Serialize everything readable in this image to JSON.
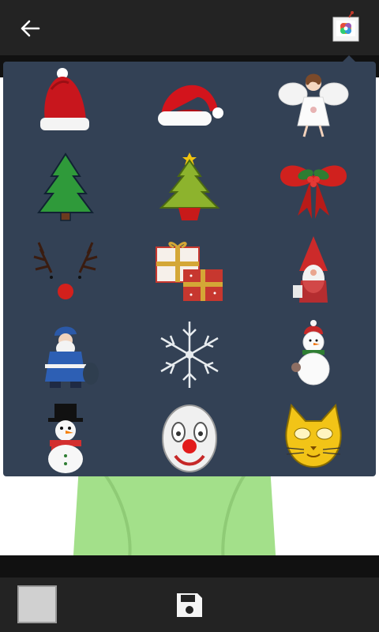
{
  "header": {
    "back_icon": "arrow-left-icon",
    "gallery_icon": "photo-gallery-icon"
  },
  "stickers": [
    {
      "name": "santa-hat-tall",
      "icon": "santa-hat-icon"
    },
    {
      "name": "santa-hat-floppy",
      "icon": "santa-hat-icon"
    },
    {
      "name": "angel",
      "icon": "angel-icon"
    },
    {
      "name": "christmas-tree-outline",
      "icon": "christmas-tree-icon"
    },
    {
      "name": "christmas-tree-potted",
      "icon": "christmas-tree-icon"
    },
    {
      "name": "holly-bow",
      "icon": "bow-icon"
    },
    {
      "name": "reindeer-antlers",
      "icon": "antlers-icon"
    },
    {
      "name": "gift-boxes",
      "icon": "gift-icon"
    },
    {
      "name": "gnome",
      "icon": "gnome-icon"
    },
    {
      "name": "santa-figure",
      "icon": "santa-icon"
    },
    {
      "name": "snowflake",
      "icon": "snowflake-icon"
    },
    {
      "name": "snowman-small",
      "icon": "snowman-icon"
    },
    {
      "name": "snowman-top-hat",
      "icon": "snowman-icon"
    },
    {
      "name": "clown-mask",
      "icon": "clown-mask-icon"
    },
    {
      "name": "cat-mask",
      "icon": "cat-mask-icon"
    }
  ],
  "bottom": {
    "color_value": "#d0d0d0",
    "save_icon": "save-icon"
  },
  "colors": {
    "topbar": "#232323",
    "panel": "#334155",
    "canvas": "#ffffff"
  }
}
